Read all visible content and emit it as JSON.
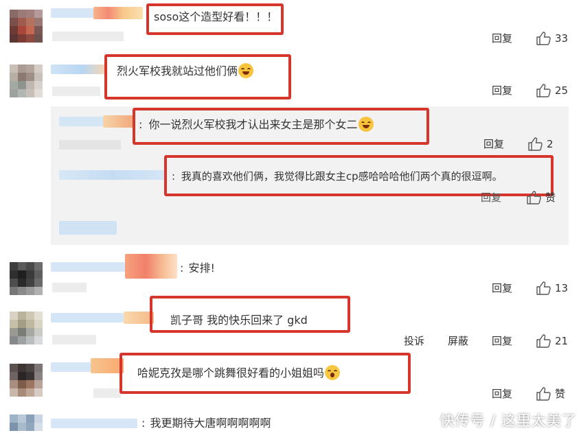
{
  "comments": [
    {
      "text": "soso这个造型好看！！！",
      "reply": "回复",
      "likes": "33"
    },
    {
      "text": "烈火军校我就站过他们俩",
      "reply": "回复",
      "likes": "25"
    },
    {
      "text": "安排!",
      "reply": "回复",
      "likes": "13"
    },
    {
      "text": "凯子哥 我的快乐回来了 gkd",
      "report": "投诉",
      "block": "屏蔽",
      "reply": "回复",
      "likes": "21"
    },
    {
      "text": "哈妮克孜是哪个跳舞很好看的小姐姐吗",
      "reply": "回复",
      "likes": "赞"
    },
    {
      "text": "我更期待大唐啊啊啊啊啊"
    }
  ],
  "replies": [
    {
      "text": "你一说烈火军校我才认出来女主是那个女二",
      "reply": "回复",
      "likes": "2"
    },
    {
      "text": "我真的喜欢他们俩，我觉得比跟女主cp感哈哈哈他们两个真的很逗啊。",
      "reply": "回复",
      "likes": "赞"
    }
  ],
  "colon": ":",
  "watermark": "快传号 / 这里太美了",
  "colors": {
    "highlight": "#d5352b",
    "subpanel": "#f2f2f2",
    "blurBlue": "#cfe3f6",
    "blurOrange": "#f6b07a"
  }
}
